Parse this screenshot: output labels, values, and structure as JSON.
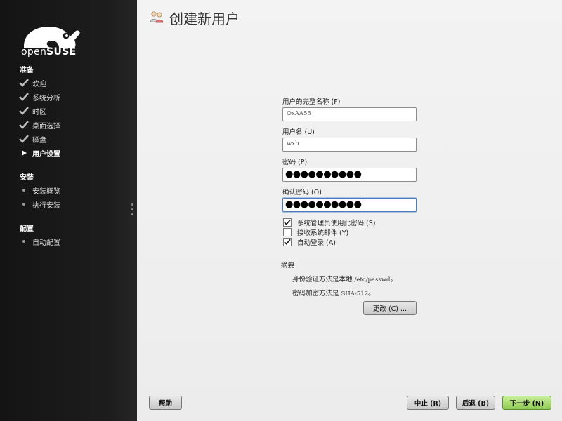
{
  "brand": {
    "logo_light": "open",
    "logo_bold": "SUSE"
  },
  "sidebar": {
    "sections": [
      {
        "title": "准备",
        "steps": [
          {
            "label": "欢迎",
            "state": "done"
          },
          {
            "label": "系统分析",
            "state": "done"
          },
          {
            "label": "时区",
            "state": "done"
          },
          {
            "label": "桌面选择",
            "state": "done"
          },
          {
            "label": "磁盘",
            "state": "done"
          },
          {
            "label": "用户设置",
            "state": "current"
          }
        ]
      },
      {
        "title": "安装",
        "steps": [
          {
            "label": "安装概览",
            "state": "pending"
          },
          {
            "label": "执行安装",
            "state": "pending"
          }
        ]
      },
      {
        "title": "配置",
        "steps": [
          {
            "label": "自动配置",
            "state": "pending"
          }
        ]
      }
    ]
  },
  "page": {
    "title": "创建新用户"
  },
  "form": {
    "fullname_label": "用户的完整名称 (F)",
    "fullname_value": "OxAA55",
    "username_label": "用户名 (U)",
    "username_value": "wxb",
    "password_label": "密码 (P)",
    "password_value": "●●●●●●●●●●",
    "confirm_label": "确认密码 (O)",
    "confirm_value": "●●●●●●●●●●"
  },
  "options": [
    {
      "label": "系统管理员使用此密码 (S)",
      "checked": true
    },
    {
      "label": "接收系统邮件 (Y)",
      "checked": false
    },
    {
      "label": "自动登录 (A)",
      "checked": true
    }
  ],
  "summary": {
    "title": "摘要",
    "auth_prefix": "身份验证方法是本地",
    "auth_value": "/etc/passwd",
    "enc_prefix": "密码加密方法是",
    "enc_value": "SHA-512",
    "period": "。",
    "change_button": "更改 (C) ..."
  },
  "footer": {
    "help": "帮助",
    "abort": "中止 (R)",
    "back": "后退 (B)",
    "next": "下一步 (N)"
  },
  "colors": {
    "next_button": "#8fcb55",
    "sidebar_bg": "#1d1d1d",
    "focus_border": "#4d7bb4"
  }
}
